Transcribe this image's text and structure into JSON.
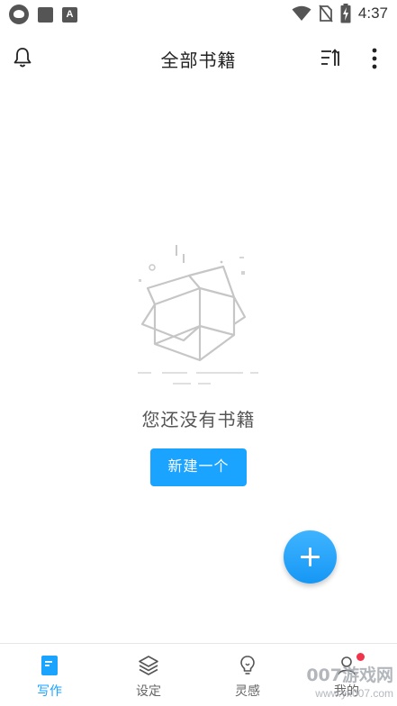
{
  "status_bar": {
    "time": "4:37",
    "left_icons": [
      "app-icon",
      "square-icon",
      "a-icon"
    ],
    "a_icon_glyph": "A",
    "right_icons": [
      "wifi-icon",
      "no-sim-icon",
      "battery-charging-icon"
    ]
  },
  "header": {
    "title": "全部书籍",
    "left_icon": "bell-icon",
    "right_icons": [
      "sort-icon",
      "more-vert-icon"
    ]
  },
  "empty_state": {
    "message": "您还没有书籍",
    "button_label": "新建一个",
    "illustration": "empty-box-icon"
  },
  "fab": {
    "icon": "plus-icon",
    "color": "#1aa3ff"
  },
  "bottom_nav": {
    "items": [
      {
        "label": "写作",
        "icon": "book-icon",
        "active": true
      },
      {
        "label": "设定",
        "icon": "layers-icon",
        "active": false
      },
      {
        "label": "灵感",
        "icon": "lightbulb-icon",
        "active": false
      },
      {
        "label": "我的",
        "icon": "profile-icon",
        "active": false,
        "badge": true
      }
    ]
  },
  "watermark": {
    "line1": "007游戏网",
    "line2": "www.yx007.com"
  },
  "colors": {
    "accent": "#1aa3ff",
    "badge": "#f0354a",
    "text_dark": "#222222",
    "text_gray": "#555555"
  }
}
